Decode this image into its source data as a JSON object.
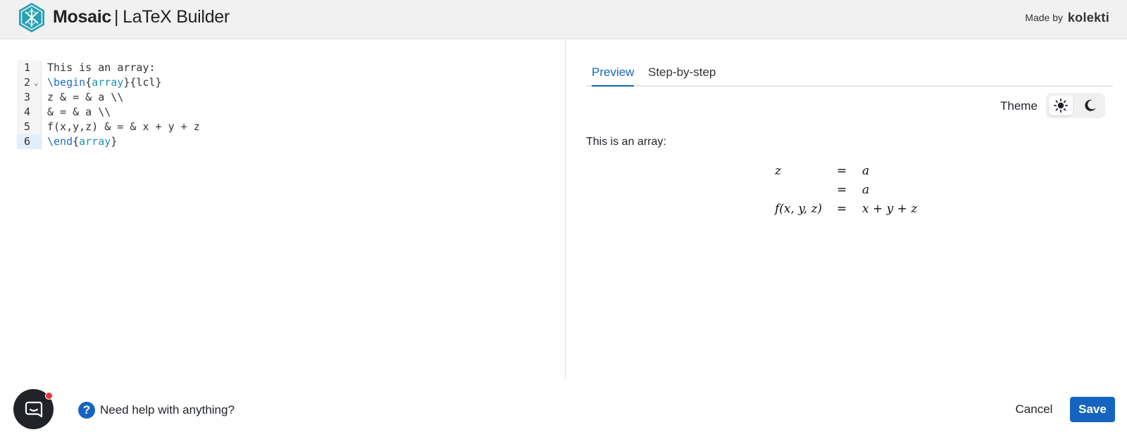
{
  "header": {
    "brand_name": "Mosaic",
    "separator": "|",
    "product": "LaTeX Builder",
    "made_by_label": "Made by",
    "made_by_brand": "kolekti"
  },
  "editor": {
    "lines": [
      {
        "number": "1",
        "tokens": [
          {
            "text": "This is an array:",
            "kind": "plain"
          }
        ]
      },
      {
        "number": "2",
        "fold": "⌄",
        "tokens": [
          {
            "text": "\\begin",
            "kind": "kw"
          },
          {
            "text": "{",
            "kind": "plain"
          },
          {
            "text": "array",
            "kind": "env"
          },
          {
            "text": "}{lcl}",
            "kind": "plain"
          }
        ]
      },
      {
        "number": "3",
        "tokens": [
          {
            "text": "z & = & a \\\\",
            "kind": "plain"
          }
        ]
      },
      {
        "number": "4",
        "tokens": [
          {
            "text": "& = & a \\\\",
            "kind": "plain"
          }
        ]
      },
      {
        "number": "5",
        "tokens": [
          {
            "text": "f(x,y,z) & = & x + y + z",
            "kind": "plain"
          }
        ]
      },
      {
        "number": "6",
        "active": true,
        "tokens": [
          {
            "text": "\\end",
            "kind": "kw"
          },
          {
            "text": "{",
            "kind": "plain"
          },
          {
            "text": "array",
            "kind": "env"
          },
          {
            "text": "}",
            "kind": "plain"
          }
        ]
      }
    ]
  },
  "preview": {
    "tabs": [
      {
        "label": "Preview",
        "active": true
      },
      {
        "label": "Step-by-step",
        "active": false
      }
    ],
    "theme_label": "Theme",
    "theme_options": [
      {
        "name": "light",
        "icon": "sun-icon",
        "selected": true
      },
      {
        "name": "dark",
        "icon": "moon-icon",
        "selected": false
      }
    ],
    "text": "This is an array:",
    "math_rows": [
      {
        "left": "z",
        "op": "=",
        "right": "a"
      },
      {
        "left": "",
        "op": "=",
        "right": "a"
      },
      {
        "left": "f(x, y, z)",
        "op": "=",
        "right": "x + y + z"
      }
    ]
  },
  "footer": {
    "chat_icon": "chat-bubble-icon",
    "help_icon": "question-icon",
    "help_symbol": "?",
    "help_text": "Need help with anything?",
    "cancel_label": "Cancel",
    "save_label": "Save"
  },
  "colors": {
    "accent": "#1565c0",
    "header_bg": "#f1f1f1",
    "latex_keyword": "#1c6fc9",
    "latex_env": "#1d93b5",
    "notification": "#e53935"
  }
}
